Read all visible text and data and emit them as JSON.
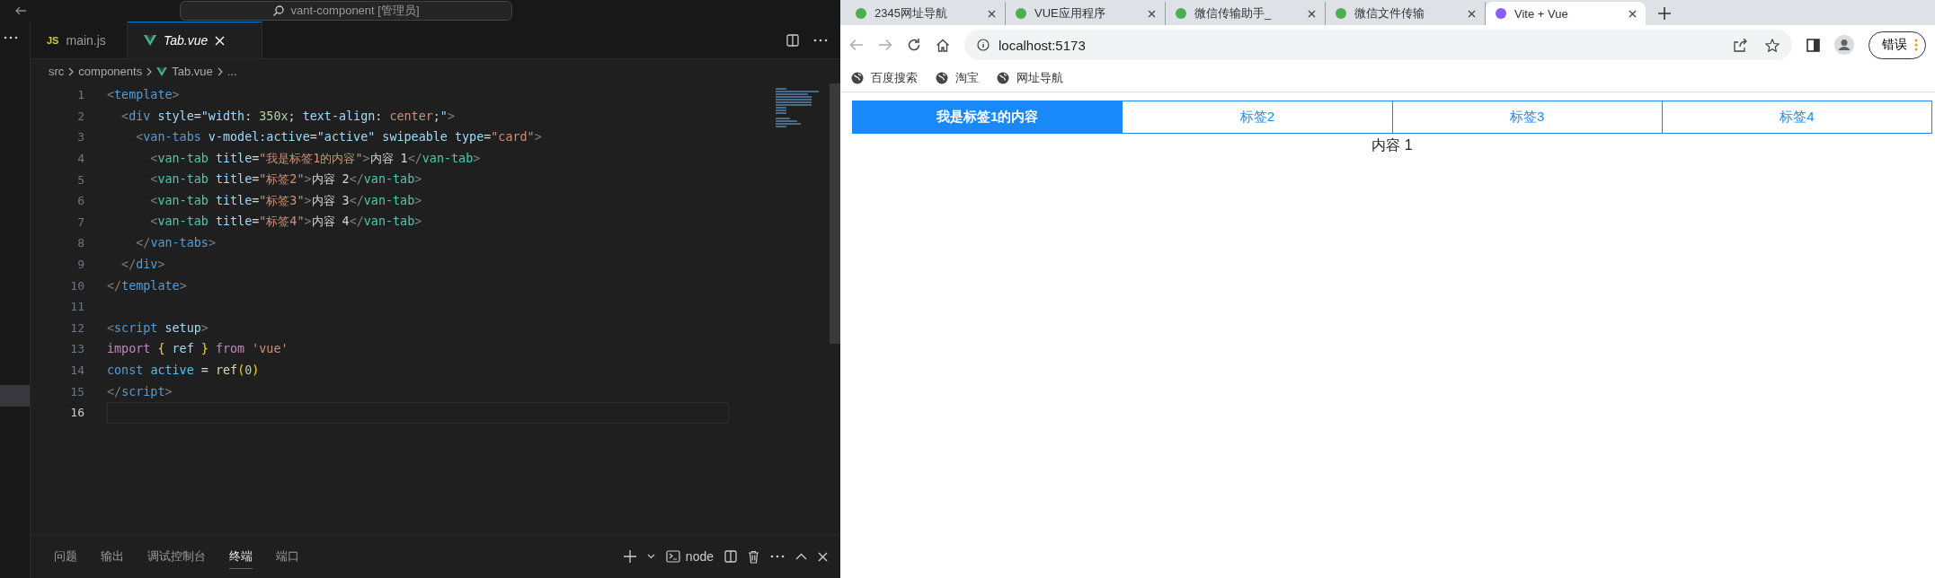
{
  "editor": {
    "window_title": "vant-component [管理员]",
    "tabs": [
      {
        "badge": "JS",
        "label": "main.js",
        "selected": false
      },
      {
        "label": "Tab.vue",
        "selected": true
      }
    ],
    "breadcrumb": [
      "src",
      "components",
      "Tab.vue",
      "..."
    ],
    "lines": [
      {
        "number": "1",
        "current": false,
        "tokens": [
          {
            "kind": "punct",
            "text": "<"
          },
          {
            "kind": "tag",
            "text": "template"
          },
          {
            "kind": "punct",
            "text": ">"
          }
        ]
      },
      {
        "number": "2",
        "current": false,
        "tokens": [
          {
            "kind": "punct",
            "text": "  <"
          },
          {
            "kind": "tag",
            "text": "div"
          },
          {
            "kind": "attr",
            "text": " style"
          },
          {
            "kind": "plain",
            "text": "="
          },
          {
            "kind": "attr",
            "text": "\"width"
          },
          {
            "kind": "plain",
            "text": ": "
          },
          {
            "kind": "number",
            "text": "350x"
          },
          {
            "kind": "plain",
            "text": "; "
          },
          {
            "kind": "attr",
            "text": "text-align"
          },
          {
            "kind": "plain",
            "text": ": "
          },
          {
            "kind": "string",
            "text": "center"
          },
          {
            "kind": "attr",
            "text": ";\""
          },
          {
            "kind": "punct",
            "text": ">"
          }
        ]
      },
      {
        "number": "3",
        "current": false,
        "tokens": [
          {
            "kind": "punct",
            "text": "    <"
          },
          {
            "kind": "tag",
            "text": "van-tabs"
          },
          {
            "kind": "attr",
            "text": " v-model:active"
          },
          {
            "kind": "plain",
            "text": "="
          },
          {
            "kind": "attr",
            "text": "\"active\""
          },
          {
            "kind": "attr",
            "text": " swipeable type"
          },
          {
            "kind": "plain",
            "text": "="
          },
          {
            "kind": "string",
            "text": "\"card\""
          },
          {
            "kind": "punct",
            "text": ">"
          }
        ]
      },
      {
        "number": "4",
        "current": false,
        "tokens": [
          {
            "kind": "punct",
            "text": "      <"
          },
          {
            "kind": "component",
            "text": "van-tab"
          },
          {
            "kind": "attr",
            "text": " title"
          },
          {
            "kind": "plain",
            "text": "="
          },
          {
            "kind": "string",
            "text": "\"我是标签1的内容\""
          },
          {
            "kind": "punct",
            "text": ">"
          },
          {
            "kind": "plain",
            "text": "内容 1"
          },
          {
            "kind": "punct",
            "text": "</"
          },
          {
            "kind": "component",
            "text": "van-tab"
          },
          {
            "kind": "punct",
            "text": ">"
          }
        ]
      },
      {
        "number": "5",
        "current": false,
        "tokens": [
          {
            "kind": "punct",
            "text": "      <"
          },
          {
            "kind": "component",
            "text": "van-tab"
          },
          {
            "kind": "attr",
            "text": " title"
          },
          {
            "kind": "plain",
            "text": "="
          },
          {
            "kind": "string",
            "text": "\"标签2\""
          },
          {
            "kind": "punct",
            "text": ">"
          },
          {
            "kind": "plain",
            "text": "内容 2"
          },
          {
            "kind": "punct",
            "text": "</"
          },
          {
            "kind": "component",
            "text": "van-tab"
          },
          {
            "kind": "punct",
            "text": ">"
          }
        ]
      },
      {
        "number": "6",
        "current": false,
        "tokens": [
          {
            "kind": "punct",
            "text": "      <"
          },
          {
            "kind": "component",
            "text": "van-tab"
          },
          {
            "kind": "attr",
            "text": " title"
          },
          {
            "kind": "plain",
            "text": "="
          },
          {
            "kind": "string",
            "text": "\"标签3\""
          },
          {
            "kind": "punct",
            "text": ">"
          },
          {
            "kind": "plain",
            "text": "内容 3"
          },
          {
            "kind": "punct",
            "text": "</"
          },
          {
            "kind": "component",
            "text": "van-tab"
          },
          {
            "kind": "punct",
            "text": ">"
          }
        ]
      },
      {
        "number": "7",
        "current": false,
        "tokens": [
          {
            "kind": "punct",
            "text": "      <"
          },
          {
            "kind": "component",
            "text": "van-tab"
          },
          {
            "kind": "attr",
            "text": " title"
          },
          {
            "kind": "plain",
            "text": "="
          },
          {
            "kind": "string",
            "text": "\"标签4\""
          },
          {
            "kind": "punct",
            "text": ">"
          },
          {
            "kind": "plain",
            "text": "内容 4"
          },
          {
            "kind": "punct",
            "text": "</"
          },
          {
            "kind": "component",
            "text": "van-tab"
          },
          {
            "kind": "punct",
            "text": ">"
          }
        ]
      },
      {
        "number": "8",
        "current": false,
        "tokens": [
          {
            "kind": "punct",
            "text": "    </"
          },
          {
            "kind": "tag",
            "text": "van-tabs"
          },
          {
            "kind": "punct",
            "text": ">"
          }
        ]
      },
      {
        "number": "9",
        "current": false,
        "tokens": [
          {
            "kind": "punct",
            "text": "  </"
          },
          {
            "kind": "tag",
            "text": "div"
          },
          {
            "kind": "punct",
            "text": ">"
          }
        ]
      },
      {
        "number": "10",
        "current": false,
        "tokens": [
          {
            "kind": "punct",
            "text": "</"
          },
          {
            "kind": "tag",
            "text": "template"
          },
          {
            "kind": "punct",
            "text": ">"
          }
        ]
      },
      {
        "number": "11",
        "current": false
      },
      {
        "number": "12",
        "current": false,
        "tokens": [
          {
            "kind": "punct",
            "text": "<"
          },
          {
            "kind": "tag",
            "text": "script"
          },
          {
            "kind": "attr",
            "text": " setup"
          },
          {
            "kind": "punct",
            "text": ">"
          }
        ]
      },
      {
        "number": "13",
        "current": false,
        "tokens": [
          {
            "kind": "keyword",
            "text": "import "
          },
          {
            "kind": "bracket",
            "text": "{"
          },
          {
            "kind": "attr",
            "text": " ref "
          },
          {
            "kind": "bracket",
            "text": "} "
          },
          {
            "kind": "keyword",
            "text": "from "
          },
          {
            "kind": "string",
            "text": "'vue'"
          }
        ]
      },
      {
        "number": "14",
        "current": false,
        "tokens": [
          {
            "kind": "tag",
            "text": "const "
          },
          {
            "kind": "variable",
            "text": "active"
          },
          {
            "kind": "plain",
            "text": " = "
          },
          {
            "kind": "function",
            "text": "ref"
          },
          {
            "kind": "bracket",
            "text": "("
          },
          {
            "kind": "number",
            "text": "0"
          },
          {
            "kind": "bracket",
            "text": ")"
          }
        ]
      },
      {
        "number": "15",
        "current": false,
        "tokens": [
          {
            "kind": "punct",
            "text": "</"
          },
          {
            "kind": "tag",
            "text": "script"
          },
          {
            "kind": "punct",
            "text": ">"
          }
        ]
      },
      {
        "number": "16",
        "current": true
      }
    ],
    "panel_tabs": [
      {
        "label": "问题",
        "selected": false
      },
      {
        "label": "输出",
        "selected": false
      },
      {
        "label": "调试控制台",
        "selected": false
      },
      {
        "label": "终端",
        "selected": true
      },
      {
        "label": "端口",
        "selected": false
      }
    ],
    "terminal_name": "node"
  },
  "browser": {
    "tabs": [
      {
        "title": "2345网址导航",
        "selected": false
      },
      {
        "title": "VUE应用程序",
        "selected": false
      },
      {
        "title": "微信传输助手_",
        "selected": false
      },
      {
        "title": "微信文件传输",
        "selected": false
      },
      {
        "title": "Vite + Vue",
        "selected": true
      }
    ],
    "address": "localhost:5173",
    "profile_button": "错误",
    "bookmarks": [
      "百度搜索",
      "淘宝",
      "网址导航"
    ],
    "page": {
      "tabs": [
        {
          "title": "我是标签1的内容",
          "selected": true
        },
        {
          "title": "标签2",
          "selected": false
        },
        {
          "title": "标签3",
          "selected": false
        },
        {
          "title": "标签4",
          "selected": false
        }
      ],
      "content": "内容 1"
    }
  }
}
